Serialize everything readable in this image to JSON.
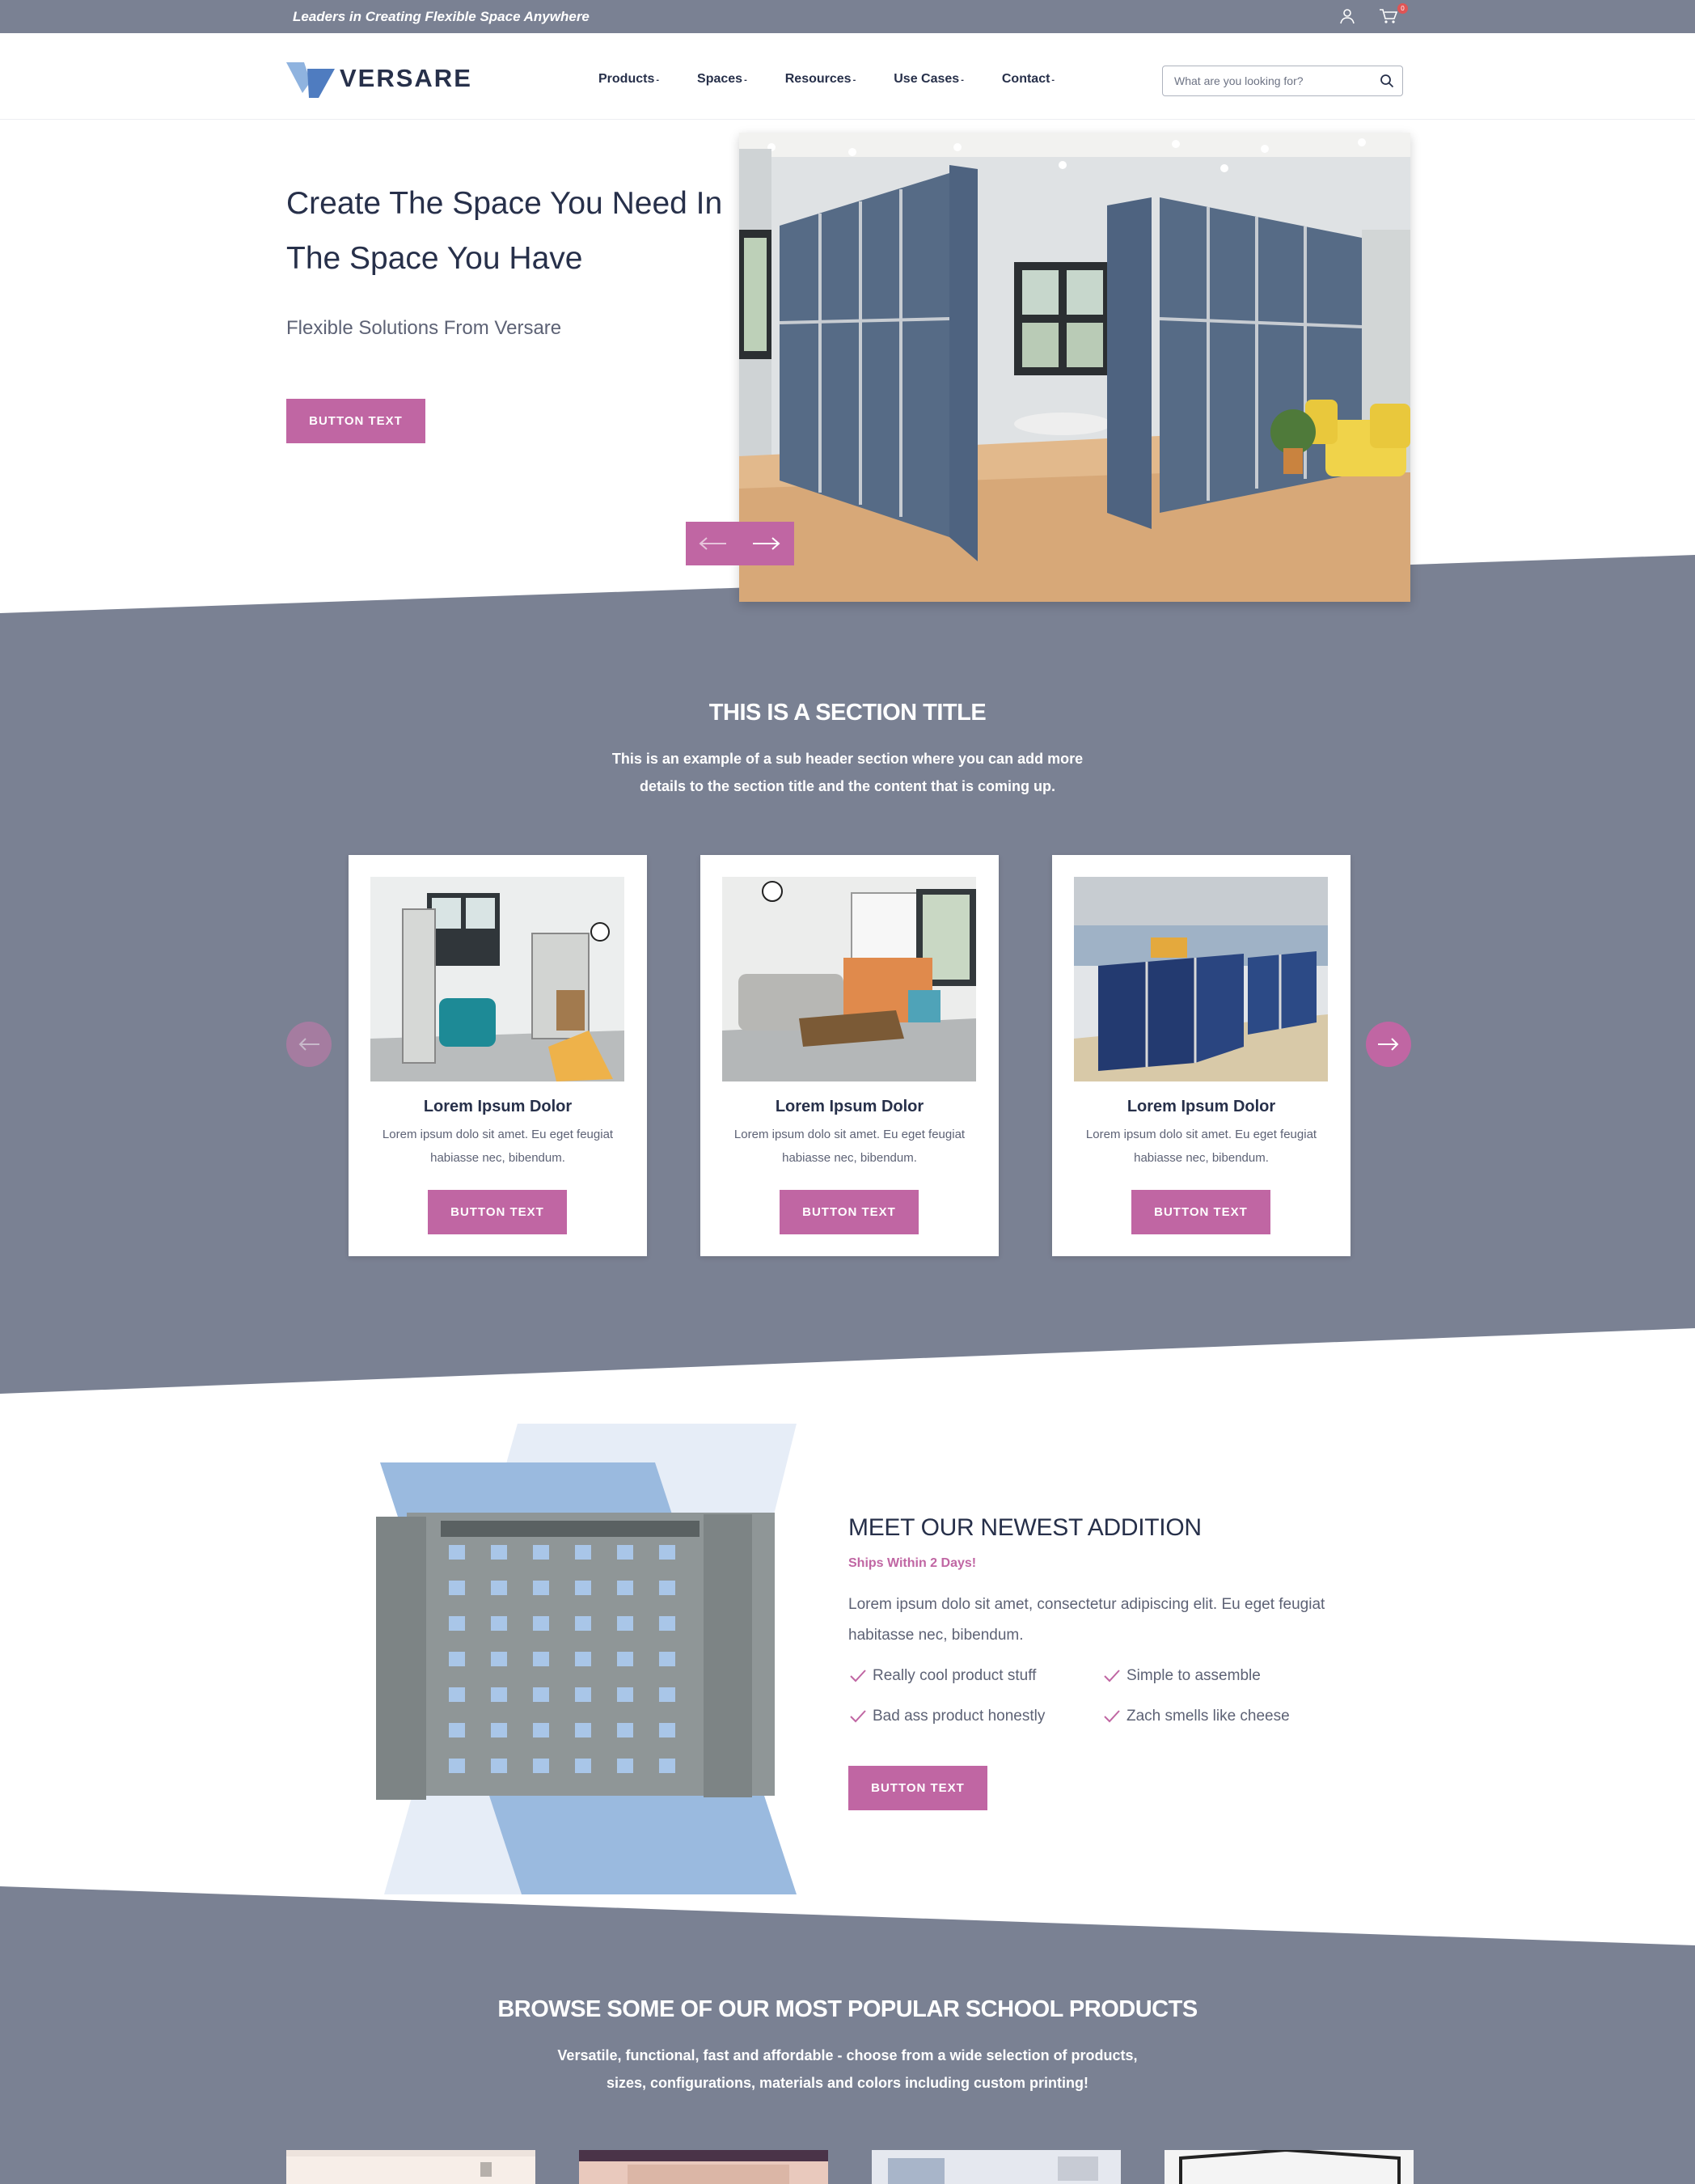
{
  "topbar": {
    "tagline": "Leaders in Creating Flexible Space Anywhere",
    "account_icon": "user-icon",
    "cart_icon": "cart-icon",
    "cart_count": "0"
  },
  "header": {
    "logo_text": "VERSARE",
    "nav": [
      {
        "label": "Products"
      },
      {
        "label": "Spaces"
      },
      {
        "label": "Resources"
      },
      {
        "label": "Use Cases"
      },
      {
        "label": "Contact"
      }
    ],
    "search_placeholder": "What are you looking for?",
    "search_icon": "magnifier-icon"
  },
  "hero": {
    "title": "Create The Space You Need In The Space You Have",
    "subtitle": "Flexible Solutions From Versare",
    "button": "BUTTON TEXT",
    "image": "office room divider photo",
    "prev_icon": "arrow-left-icon",
    "next_icon": "arrow-right-icon"
  },
  "section": {
    "title": "THIS IS A SECTION TITLE",
    "subtitle_line1": "This is an example of a sub header section where you can add more",
    "subtitle_line2": "details to the section title and the content that is coming up.",
    "cards": [
      {
        "title": "Lorem Ipsum Dolor",
        "text": "Lorem ipsum dolo sit amet. Eu eget feugiat habiasse nec, bibendum.",
        "button": "BUTTON TEXT"
      },
      {
        "title": "Lorem Ipsum Dolor",
        "text": "Lorem ipsum dolo sit amet. Eu eget feugiat habiasse nec, bibendum.",
        "button": "BUTTON TEXT"
      },
      {
        "title": "Lorem Ipsum Dolor",
        "text": "Lorem ipsum dolo sit amet. Eu eget feugiat habiasse nec, bibendum.",
        "button": "BUTTON TEXT"
      }
    ]
  },
  "newest": {
    "title": "MEET OUR NEWEST ADDITION",
    "ships": "Ships Within 2 Days!",
    "description": "Lorem ipsum dolo sit amet, consectetur adipiscing elit. Eu eget feugiat habitasse nec, bibendum.",
    "features": [
      "Really cool product stuff",
      "Simple to assemble",
      "Bad ass product honestly",
      "Zach smells like cheese"
    ],
    "button": "BUTTON TEXT"
  },
  "browse": {
    "title": "BROWSE SOME OF OUR MOST POPULAR SCHOOL PRODUCTS",
    "subtitle_line1": "Versatile, functional, fast and affordable - choose from a wide selection of products,",
    "subtitle_line2": "sizes, configurations, materials and colors including custom printing!"
  },
  "colors": {
    "accent": "#c066a3",
    "band": "#7a8193",
    "navy": "#27304a"
  }
}
